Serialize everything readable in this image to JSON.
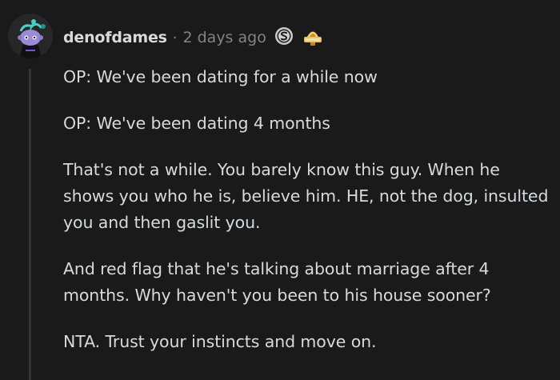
{
  "comment": {
    "author": "denofdames",
    "separator": "·",
    "timestamp": "2 days ago",
    "awards": [
      {
        "icon": "silver-award-icon"
      },
      {
        "icon": "helpful-award-icon"
      }
    ],
    "paragraphs": [
      "OP: We've been dating for a while now",
      "OP: We've been dating 4 months",
      "That's not a while. You barely know this guy. When he shows you who he is, believe him. HE, not the dog, insulted you and then gaslit you.",
      "And red flag that he's talking about marriage after 4 months. Why haven't you been to his house sooner?",
      "NTA. Trust your instincts and move on."
    ]
  },
  "colors": {
    "background": "#1a1a1b",
    "text": "#d7dadc",
    "meta": "#818384",
    "thread_line": "#343536",
    "avatar_accent": "#46d1c6"
  }
}
